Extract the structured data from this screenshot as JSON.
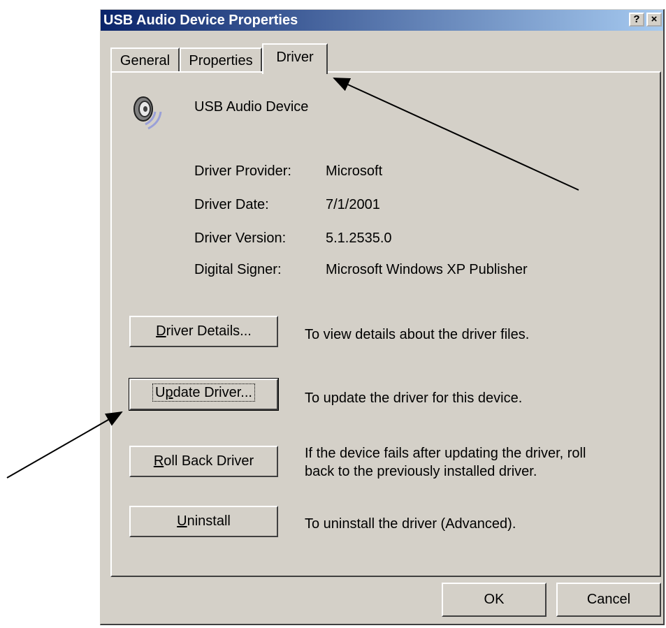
{
  "window": {
    "title": "USB Audio Device Properties"
  },
  "titlebar_buttons": {
    "help": "?",
    "close": "×"
  },
  "tabs": [
    {
      "label": "General"
    },
    {
      "label": "Properties"
    },
    {
      "label": "Driver"
    }
  ],
  "device": {
    "name": "USB Audio Device",
    "icon": "speaker-icon"
  },
  "info": [
    {
      "label": "Driver Provider:",
      "value": "Microsoft"
    },
    {
      "label": "Driver Date:",
      "value": "7/1/2001"
    },
    {
      "label": "Driver Version:",
      "value": "5.1.2535.0"
    },
    {
      "label": "Digital Signer:",
      "value": "Microsoft Windows XP Publisher"
    }
  ],
  "actions": [
    {
      "accel": "D",
      "rest": "river Details...",
      "desc": "To view details about the driver files."
    },
    {
      "pre": "U",
      "accel": "p",
      "rest": "date Driver...",
      "desc": "To update the driver for this device."
    },
    {
      "accel": "R",
      "rest": "oll Back Driver",
      "desc_line1": "If the device fails after updating the driver, roll",
      "desc_line2": "back to the previously installed driver."
    },
    {
      "accel": "U",
      "rest": "ninstall",
      "desc": "To uninstall the driver (Advanced)."
    }
  ],
  "footer": {
    "ok": "OK",
    "cancel": "Cancel"
  },
  "colors": {
    "face": "#d4d0c8",
    "title_start": "#0a246a",
    "title_end": "#a6caf0"
  }
}
